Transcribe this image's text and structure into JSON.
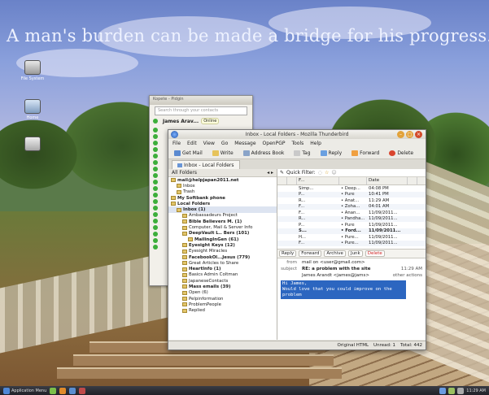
{
  "desktop": {
    "quote": "A man's burden can be made a bridge for his progress.",
    "icons": [
      {
        "name": "file-system",
        "label": "File System"
      },
      {
        "name": "home",
        "label": "Home"
      },
      {
        "name": "trash",
        "label": ""
      }
    ]
  },
  "contacts_window": {
    "title": "Kopete - Pidgin",
    "search_placeholder": "Search through your contacts",
    "me_name": "James Arav...",
    "me_status": "Online",
    "contact_count": 19
  },
  "thunderbird": {
    "title": "Inbox - Local Folders - Mozilla Thunderbird",
    "menu": [
      "File",
      "Edit",
      "View",
      "Go",
      "Message",
      "OpenPGP",
      "Tools",
      "Help"
    ],
    "toolbar": [
      "Get Mail",
      "Write",
      "Address Book",
      "Tag",
      "Reply",
      "Forward",
      "Delete"
    ],
    "tab_label": "Inbox - Local Folders",
    "folder_header": "All Folders",
    "quick_filter": "Quick Filter:",
    "folders": [
      {
        "label": "mail@helpjapan2011.net",
        "level": 0,
        "bold": true
      },
      {
        "label": "Inbox",
        "level": 1,
        "bold": false
      },
      {
        "label": "Trash",
        "level": 1,
        "bold": false
      },
      {
        "label": "My Softbank phone",
        "level": 0,
        "bold": true
      },
      {
        "label": "Local Folders",
        "level": 0,
        "bold": true
      },
      {
        "label": "Inbox (1)",
        "level": 1,
        "bold": true,
        "selected": true
      },
      {
        "label": "Ambassadeurs Project",
        "level": 2,
        "bold": false
      },
      {
        "label": "Bible Believers M. (1)",
        "level": 2,
        "bold": true
      },
      {
        "label": "Computer, Mail & Server Info",
        "level": 2,
        "bold": false
      },
      {
        "label": "DeepVault L.. Bers (101)",
        "level": 2,
        "bold": true
      },
      {
        "label": "MailingInGen (61)",
        "level": 3,
        "bold": true
      },
      {
        "label": "Eyesight Keys (12)",
        "level": 2,
        "bold": true
      },
      {
        "label": "Eyesight Miracles",
        "level": 2,
        "bold": false
      },
      {
        "label": "FacebookOl...Jesus (779)",
        "level": 2,
        "bold": true
      },
      {
        "label": "Great Articles to Share",
        "level": 2,
        "bold": false
      },
      {
        "label": "HeartInfo (1)",
        "level": 2,
        "bold": true
      },
      {
        "label": "Basics Admin Coltman",
        "level": 2,
        "bold": false
      },
      {
        "label": "JapaneseContacts",
        "level": 2,
        "bold": false
      },
      {
        "label": "Mass emails (39)",
        "level": 2,
        "bold": true
      },
      {
        "label": "Open (6)",
        "level": 2,
        "bold": false
      },
      {
        "label": "Pelpinformation",
        "level": 2,
        "bold": false
      },
      {
        "label": "ProblemPeople",
        "level": 2,
        "bold": false
      },
      {
        "label": "Replied",
        "level": 2,
        "bold": false
      }
    ],
    "columns": [
      "",
      "",
      "F...",
      "",
      "Date",
      ""
    ],
    "messages": [
      {
        "from": "Simp...",
        "flag": "• Deep...",
        "date": "04:08 PM",
        "bold": false
      },
      {
        "from": "P...",
        "flag": "• Pure",
        "date": "10:41 PM",
        "bold": false
      },
      {
        "from": "R...",
        "flag": "• Anat...",
        "date": "11:29 AM",
        "bold": false
      },
      {
        "from": "F...",
        "flag": "• Zoha...",
        "date": "04:01 AM",
        "bold": false
      },
      {
        "from": "F...",
        "flag": "• Anan...",
        "date": "11/09/2011...",
        "bold": false
      },
      {
        "from": "R...",
        "flag": "• Pandha...",
        "date": "11/09/2011...",
        "bold": false
      },
      {
        "from": "P...",
        "flag": "• Pure",
        "date": "11/09/2011...",
        "bold": false
      },
      {
        "from": "S...",
        "flag": "• Ford...",
        "date": "11/09/2011...",
        "bold": true
      },
      {
        "from": "H...",
        "flag": "• Pure...",
        "date": "11/09/2011...",
        "bold": false
      },
      {
        "from": "F...",
        "flag": "• Pure...",
        "date": "11/09/2011...",
        "bold": false
      }
    ],
    "actions": [
      "Reply",
      "Forward",
      "Archive",
      "Junk",
      "Delete"
    ],
    "header": {
      "from_key": "from",
      "from": "mail on <user@gmail.com>",
      "subject_key": "subject",
      "subject": "RE: a problem with the site",
      "time": "11:29 AM",
      "to": "James Arandt <james@jams>",
      "other": "other actions"
    },
    "quoted": [
      "Hi James,",
      "Would love that you could improve on the",
      "problem"
    ],
    "status": {
      "encoding": "Original HTML",
      "unread": "Unread: 1",
      "total": "Total: 442"
    }
  },
  "taskbar": {
    "start_label": "Application Menu",
    "clock": "11:29 AM"
  }
}
